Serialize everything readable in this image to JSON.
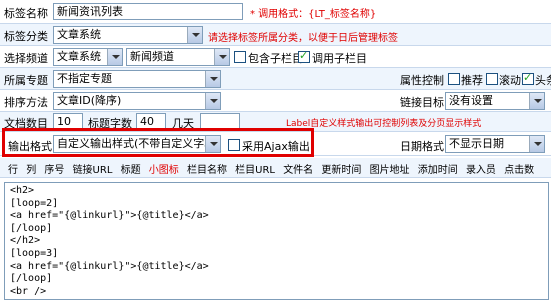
{
  "form": {
    "name_label": "标签名称",
    "name_value": "新闻资讯列表",
    "name_hint": "* 调用格式：{LT_标签名称}",
    "category_label": "标签分类",
    "category_value": "文章系统",
    "category_hint": "请选择标签所属分类，以便于日后管理标签",
    "channel_label": "选择频道",
    "channel_value": "文章系统",
    "column_value": "新闻频道",
    "include_sub_label": "包含子栏目",
    "include_sub_checked": false,
    "call_sub_label": "调用子栏目",
    "call_sub_checked": true,
    "special_label": "所属专题",
    "special_value": "不指定专题",
    "attr_label": "属性控制",
    "attr_recommend": "推荐",
    "attr_scroll": "滚动",
    "attr_headline": "头条",
    "sort_label": "排序方法",
    "sort_value": "文章ID(降序)",
    "open_label": "链接目标",
    "open_value": "没有设置",
    "count_label": "文档数目",
    "count_value": "10",
    "title_len_label": "标题字数",
    "title_len_value": "40",
    "days_label": "几天",
    "output_label": "输出格式",
    "output_value": "自定义输出样式(不带自定义字段)",
    "ajax_label": "采用Ajax输出",
    "ajax_checked": false,
    "date_label": "日期格式",
    "date_value": "不显示日期",
    "custom_hint": "Label自定义样式输出可控制列表及分页显示样式"
  },
  "tags": {
    "labels": [
      "行",
      "列",
      "序号",
      "链接URL",
      "标题",
      "小图标",
      "栏目名称",
      "栏目URL",
      "文件名",
      "更新时间",
      "图片地址",
      "添加时间",
      "录入员",
      "点击数"
    ]
  },
  "template": {
    "lines": [
      "<h2>",
      "[loop=2]",
      "<a href=\"{@linkurl}\">{@title}</a>",
      "[/loop]",
      "</h2>",
      "[loop=3]",
      "<a href=\"{@linkurl}\">{@title}</a>",
      "[/loop]",
      "<br />"
    ]
  },
  "colors": {
    "row_bg": "#eef5fd",
    "highlight_border": "#e00000",
    "accent_red": "#e00000"
  }
}
